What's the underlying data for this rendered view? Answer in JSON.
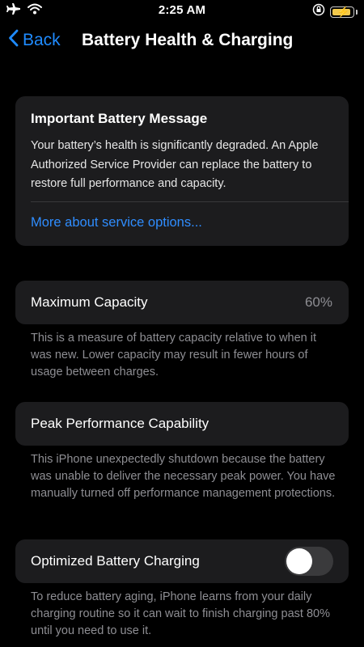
{
  "status_bar": {
    "time": "2:25 AM",
    "icons": [
      "airplane-icon",
      "wifi-icon",
      "orientation-lock-icon",
      "battery-charging-icon"
    ],
    "battery_color": "#f2c94c"
  },
  "nav": {
    "back_label": "Back",
    "title": "Battery Health & Charging",
    "accent": "#1f8bff"
  },
  "message": {
    "title": "Important Battery Message",
    "body": "Your battery’s health is significantly degraded. An Apple Authorized Service Provider can replace the battery to restore full performance and capacity.",
    "link": "More about service options..."
  },
  "max_capacity": {
    "label": "Maximum Capacity",
    "value": "60%",
    "footnote": "This is a measure of battery capacity relative to when it was new. Lower capacity may result in fewer hours of usage between charges."
  },
  "peak_performance": {
    "label": "Peak Performance Capability",
    "footnote": "This iPhone unexpectedly shutdown because the battery was unable to deliver the necessary peak power. You have manually turned off performance management protections."
  },
  "optimized_charging": {
    "label": "Optimized Battery Charging",
    "enabled": false,
    "footnote": "To reduce battery aging, iPhone learns from your daily charging routine so it can wait to finish charging past 80% until you need to use it."
  }
}
